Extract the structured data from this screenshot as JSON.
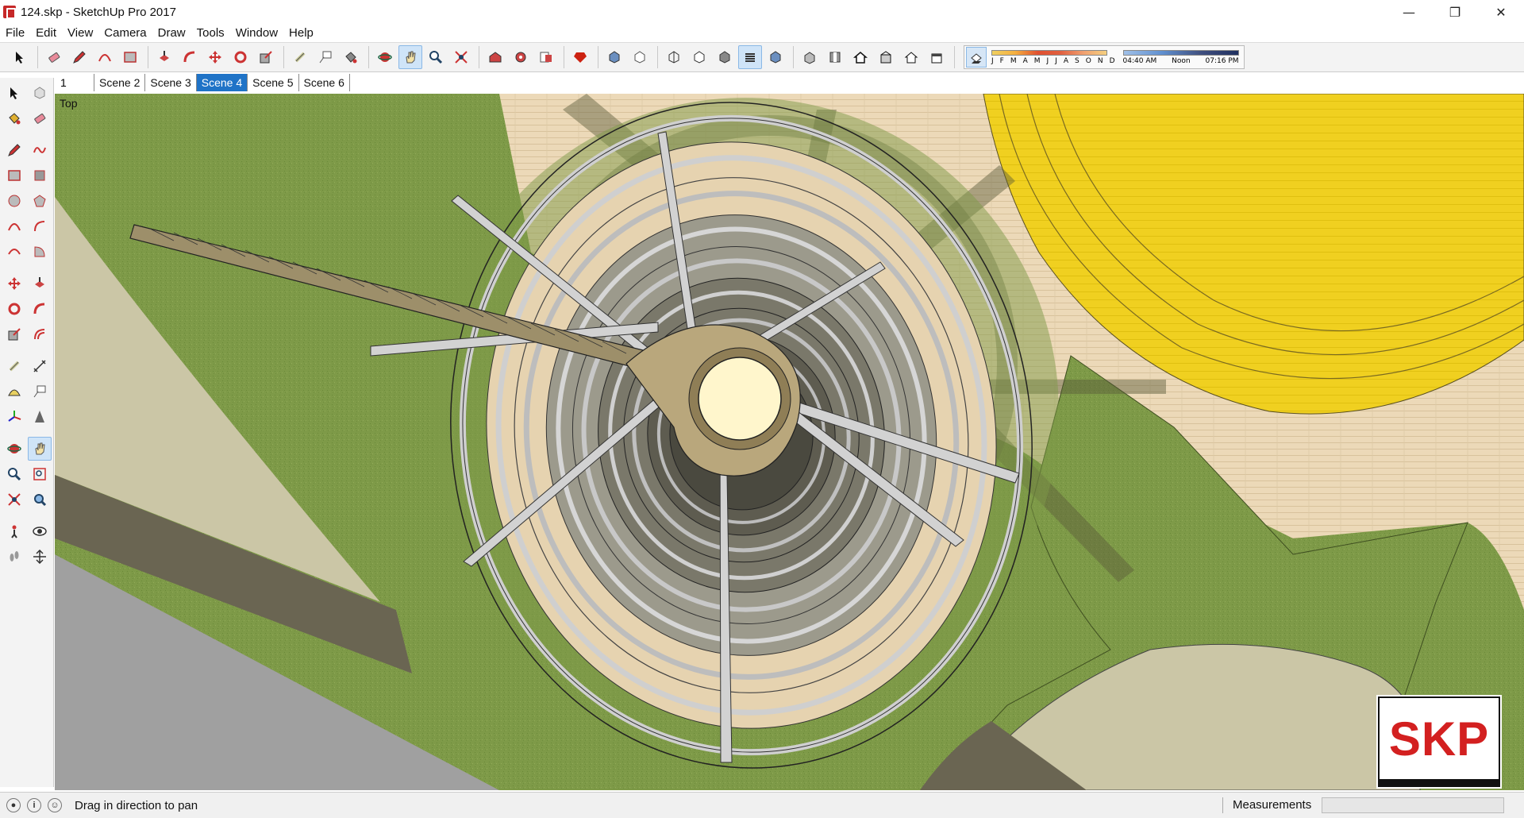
{
  "window": {
    "title": "124.skp - SketchUp Pro 2017",
    "controls": [
      "minimize",
      "restore",
      "close"
    ]
  },
  "menu": [
    "File",
    "Edit",
    "View",
    "Camera",
    "Draw",
    "Tools",
    "Window",
    "Help"
  ],
  "toolbar": {
    "groups": [
      [
        "select-icon",
        "eraser-icon",
        "pencil-icon",
        "arc-icon",
        "rectangle-icon"
      ],
      [
        "push-pull-icon",
        "follow-me-icon",
        "move-icon",
        "rotate-icon",
        "scale-icon"
      ],
      [
        "tape-measure-icon",
        "text-icon",
        "paint-bucket-icon"
      ],
      [
        "orbit-icon",
        "pan-icon",
        "zoom-icon",
        "zoom-extents-icon"
      ],
      [
        "warehouse-icon",
        "extension-icon",
        "send-layout-icon"
      ],
      [
        "ruby-icon"
      ],
      [
        "xray-icon",
        "back-edges-icon"
      ],
      [
        "wireframe-icon",
        "hidden-line-icon",
        "shaded-icon",
        "shaded-textures-icon",
        "monochrome-icon"
      ],
      [
        "iso-view-icon",
        "top-view-icon",
        "front-view-icon",
        "right-view-icon",
        "back-view-icon",
        "left-view-icon"
      ]
    ],
    "active_tool": "pan-icon",
    "shadows": {
      "months": [
        "J",
        "F",
        "M",
        "A",
        "M",
        "J",
        "J",
        "A",
        "S",
        "O",
        "N",
        "D"
      ],
      "time_start": "04:40 AM",
      "time_mid": "Noon",
      "time_end": "07:16 PM"
    }
  },
  "scenes": {
    "number": "1",
    "tabs": [
      "Scene 2",
      "Scene 3",
      "Scene 4",
      "Scene 5",
      "Scene 6"
    ],
    "active": "Scene 4"
  },
  "viewport": {
    "view_label": "Top",
    "logo_text": "SKP",
    "colors": {
      "grass": "#7e9a48",
      "path": "#ecd9b8",
      "plaza_yellow": "#f0d020",
      "tower_light": "#c9c9c9",
      "center": "#fff6cc"
    }
  },
  "status": {
    "message": "Drag in direction to pan",
    "measurements_label": "Measurements",
    "measurements_value": ""
  }
}
